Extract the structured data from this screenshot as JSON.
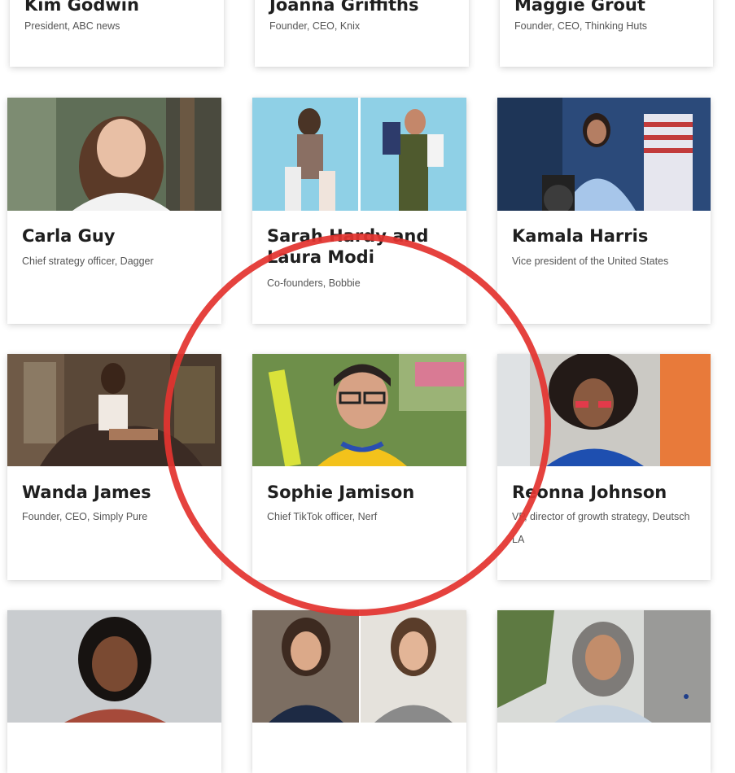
{
  "cards": [
    {
      "name": "Kim Godwin",
      "role": "President, ABC news"
    },
    {
      "name": "Joanna Griffiths",
      "role": "Founder, CEO, Knix"
    },
    {
      "name": "Maggie Grout",
      "role": "Founder, CEO, Thinking Huts"
    },
    {
      "name": "Carla Guy",
      "role": "Chief strategy officer, Dagger"
    },
    {
      "name": "Sarah Hardy and Laura Modi",
      "role": "Co-founders, Bobbie"
    },
    {
      "name": "Kamala Harris",
      "role": "Vice president of the United States"
    },
    {
      "name": "Wanda James",
      "role": "Founder, CEO, Simply Pure"
    },
    {
      "name": "Sophie Jamison",
      "role": "Chief TikTok officer, Nerf"
    },
    {
      "name": "Reonna Johnson",
      "role": "VP, director of growth strategy, Deutsch LA"
    }
  ],
  "colors": {
    "annotation_circle": "#e3342f",
    "card_bg": "#ffffff",
    "name_text": "#1f1f1f",
    "role_text": "#555555"
  }
}
